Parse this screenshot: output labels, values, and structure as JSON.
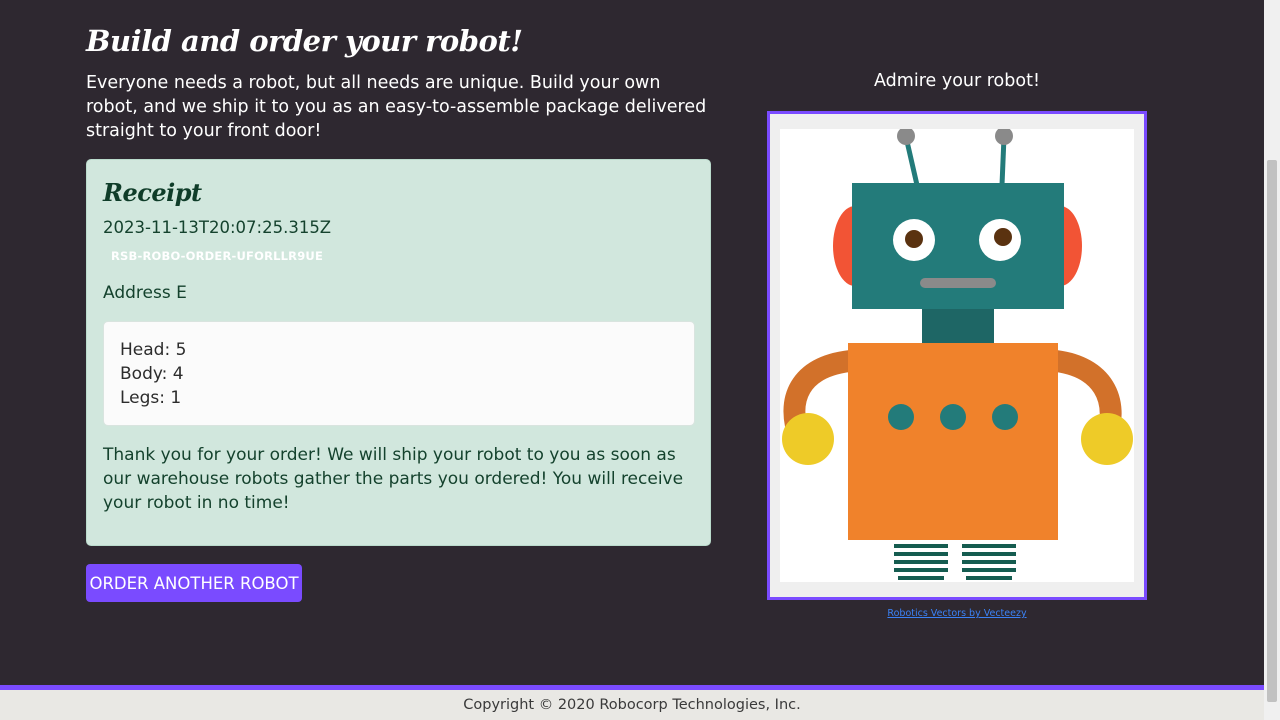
{
  "page": {
    "title": "Build and order your robot!",
    "intro": "Everyone needs a robot, but all needs are unique. Build your own robot, and we ship it to you as an easy-to-assemble package delivered straight to your front door!"
  },
  "receipt": {
    "heading": "Receipt",
    "timestamp": "2023-11-13T20:07:25.315Z",
    "order_id": "RSB-ROBO-ORDER-UFORLLR9UE",
    "address": "Address E",
    "parts": {
      "head": "Head: 5",
      "body": "Body: 4",
      "legs": "Legs: 1"
    },
    "thanks": "Thank you for your order! We will ship your robot to you as soon as our warehouse robots gather the parts you ordered! You will receive your robot in no time!"
  },
  "actions": {
    "order_another": "ORDER ANOTHER ROBOT"
  },
  "preview": {
    "heading": "Admire your robot!",
    "credit": "Robotics Vectors by Vecteezy"
  },
  "footer": {
    "copyright": "Copyright © 2020 Robocorp Technologies, Inc."
  },
  "colors": {
    "accent": "#7a4bff",
    "background": "#2e2830",
    "receipt_bg": "#d1e7dd",
    "robot_head": "#237b7a",
    "robot_body": "#f0822b",
    "robot_arms": "#d2712a",
    "robot_hands": "#eecb28",
    "robot_ears": "#f25435"
  }
}
